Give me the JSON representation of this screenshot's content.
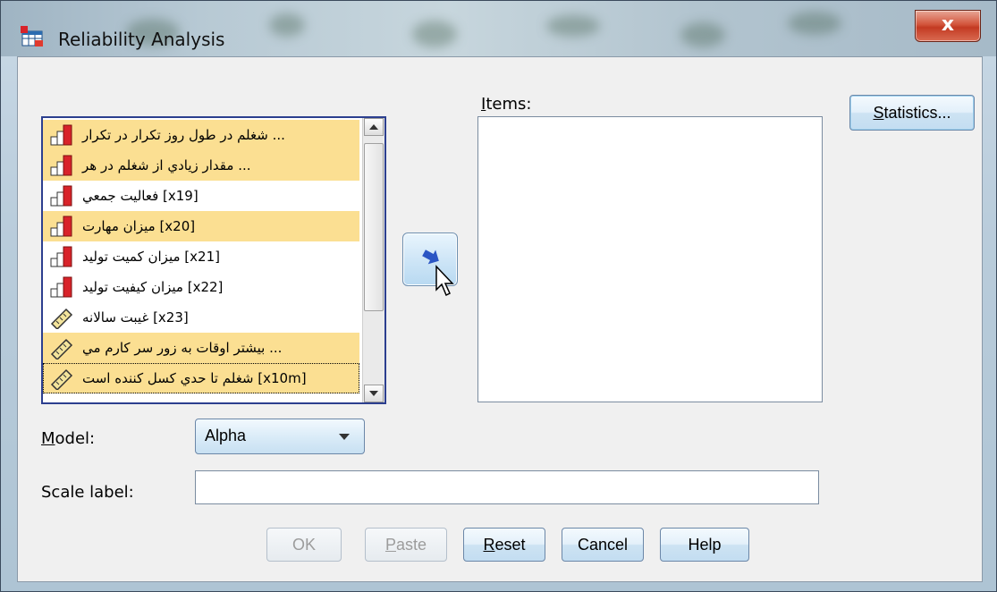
{
  "window": {
    "title": "Reliability Analysis",
    "close_glyph": "x"
  },
  "variables": [
    {
      "label": "شغلم در طول روز تکرار در تکرار ...",
      "icon": "ordinal-bar-icon",
      "selected": true
    },
    {
      "label": "مقدار زيادي از شغلم در هر ...",
      "icon": "ordinal-bar-icon",
      "selected": true
    },
    {
      "label": "فعاليت جمعي [x19]",
      "icon": "ordinal-bar-icon",
      "selected": false
    },
    {
      "label": "ميزان مهارت [x20]",
      "icon": "ordinal-bar-icon",
      "selected": true
    },
    {
      "label": "ميزان کميت توليد [x21]",
      "icon": "ordinal-bar-icon",
      "selected": false
    },
    {
      "label": "ميزان کيفيت توليد [x22]",
      "icon": "ordinal-bar-icon",
      "selected": false
    },
    {
      "label": "غيبت سالانه [x23]",
      "icon": "scale-ruler-icon",
      "selected": false
    },
    {
      "label": "بيشتر اوقات به زور سر کارم مي ...",
      "icon": "scale-ruler-icon",
      "selected": true
    },
    {
      "label": "شغلم تا حدي کسل کننده است [x10m]",
      "icon": "scale-ruler-icon",
      "selected": true
    }
  ],
  "items_label": {
    "mnemonic": "I",
    "rest": "tems:"
  },
  "buttons": {
    "statistics": {
      "mnemonic": "S",
      "rest": "tatistics..."
    },
    "ok": "OK",
    "paste": {
      "mnemonic": "P",
      "rest": "aste"
    },
    "reset": {
      "mnemonic": "R",
      "rest": "eset"
    },
    "cancel": "Cancel",
    "help": "Help"
  },
  "model": {
    "label_mnemonic": "M",
    "label_rest": "odel:",
    "selected": "Alpha"
  },
  "scale_label": {
    "label": "Scale label:",
    "value": ""
  },
  "colors": {
    "selection": "#fbdf92",
    "list_border": "#2c3f8f",
    "ordinal_bar": "#d8232a"
  }
}
